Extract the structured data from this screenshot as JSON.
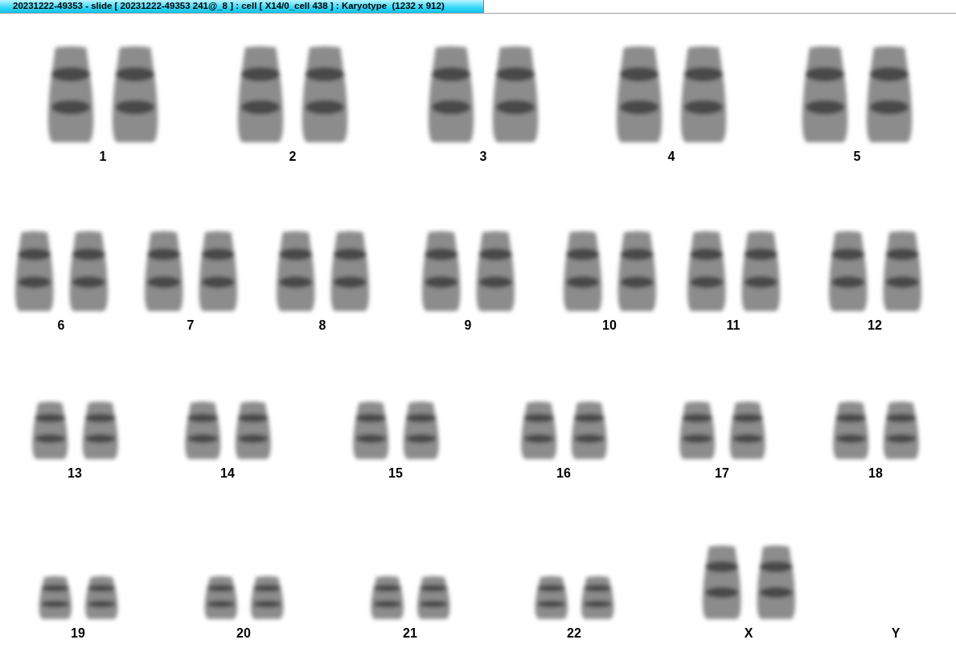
{
  "window": {
    "title": "20231222-49353 - slide [ 20231222-49353 241@_8 ] : cell [ X14/0_cell 438 ] : Karyotype  (1232 x 912)"
  },
  "karyotype": [
    {
      "label": "1",
      "kind": "pair"
    },
    {
      "label": "2",
      "kind": "pair"
    },
    {
      "label": "3",
      "kind": "pair"
    },
    {
      "label": "4",
      "kind": "pair"
    },
    {
      "label": "5",
      "kind": "pair"
    },
    {
      "label": "6",
      "kind": "pair"
    },
    {
      "label": "7",
      "kind": "pair"
    },
    {
      "label": "8",
      "kind": "pair"
    },
    {
      "label": "9",
      "kind": "pair"
    },
    {
      "label": "10",
      "kind": "pair"
    },
    {
      "label": "11",
      "kind": "pair"
    },
    {
      "label": "12",
      "kind": "pair"
    },
    {
      "label": "13",
      "kind": "pair"
    },
    {
      "label": "14",
      "kind": "pair"
    },
    {
      "label": "15",
      "kind": "pair"
    },
    {
      "label": "16",
      "kind": "pair"
    },
    {
      "label": "17",
      "kind": "pair"
    },
    {
      "label": "18",
      "kind": "pair"
    },
    {
      "label": "19",
      "kind": "pair"
    },
    {
      "label": "20",
      "kind": "pair"
    },
    {
      "label": "21",
      "kind": "pair"
    },
    {
      "label": "22",
      "kind": "pair"
    },
    {
      "label": "X",
      "kind": "pair"
    },
    {
      "label": "Y",
      "kind": "empty"
    }
  ]
}
